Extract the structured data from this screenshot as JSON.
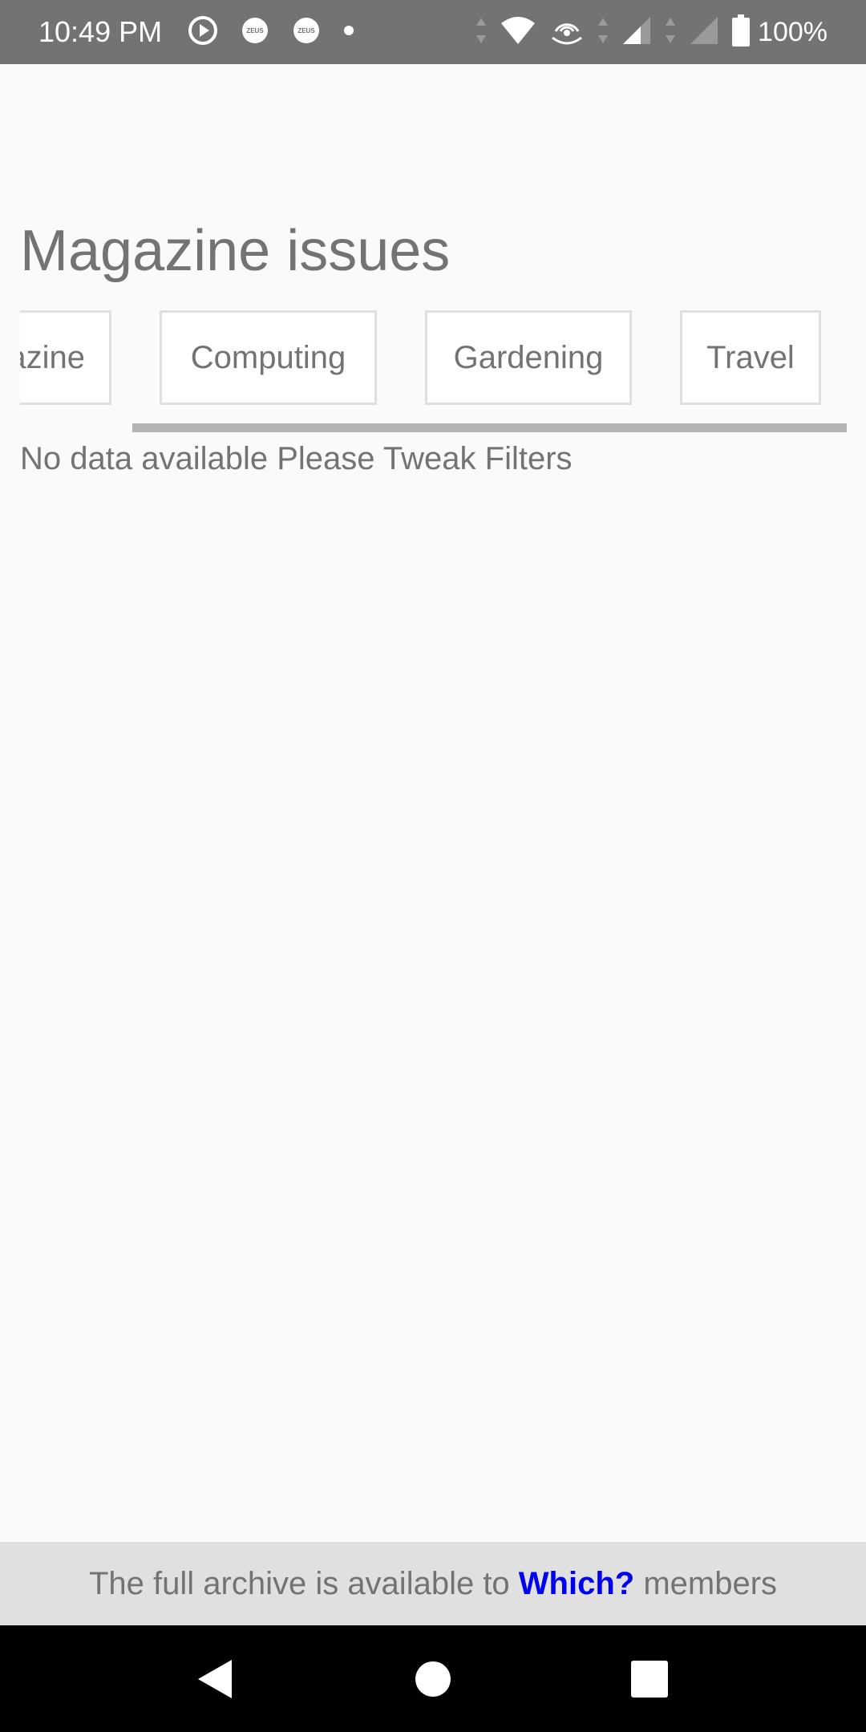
{
  "status_bar": {
    "time": "10:49 PM",
    "battery_percent": "100%",
    "left_icons": [
      "play-circle-icon",
      "app-notification-icon",
      "app-notification-icon",
      "dot-icon"
    ],
    "right_icons": [
      "data-arrows-icon",
      "wifi-icon",
      "hotspot-icon",
      "data-arrows-icon",
      "cell-signal-icon",
      "data-arrows-icon",
      "cell-signal-icon",
      "battery-icon"
    ],
    "app_badge_text": "ZEUS"
  },
  "page": {
    "title": "Magazine issues",
    "empty_message": "No data available Please Tweak Filters"
  },
  "categories": [
    {
      "label": "azine"
    },
    {
      "label": "Computing"
    },
    {
      "label": "Gardening"
    },
    {
      "label": "Travel"
    }
  ],
  "footer": {
    "text_before": "The full archive is available to ",
    "brand": "Which?",
    "text_after": " members"
  },
  "nav": {
    "back_icon": "back-triangle-icon",
    "home_icon": "home-circle-icon",
    "recents_icon": "recents-square-icon"
  },
  "colors": {
    "status_bar_bg": "#737373",
    "page_bg": "#fafafa",
    "text_gray": "#737373",
    "chip_border": "#e0e0e0",
    "footer_bg": "#e0e0e0",
    "brand_blue": "#0000f0",
    "nav_bar_bg": "#000000"
  }
}
